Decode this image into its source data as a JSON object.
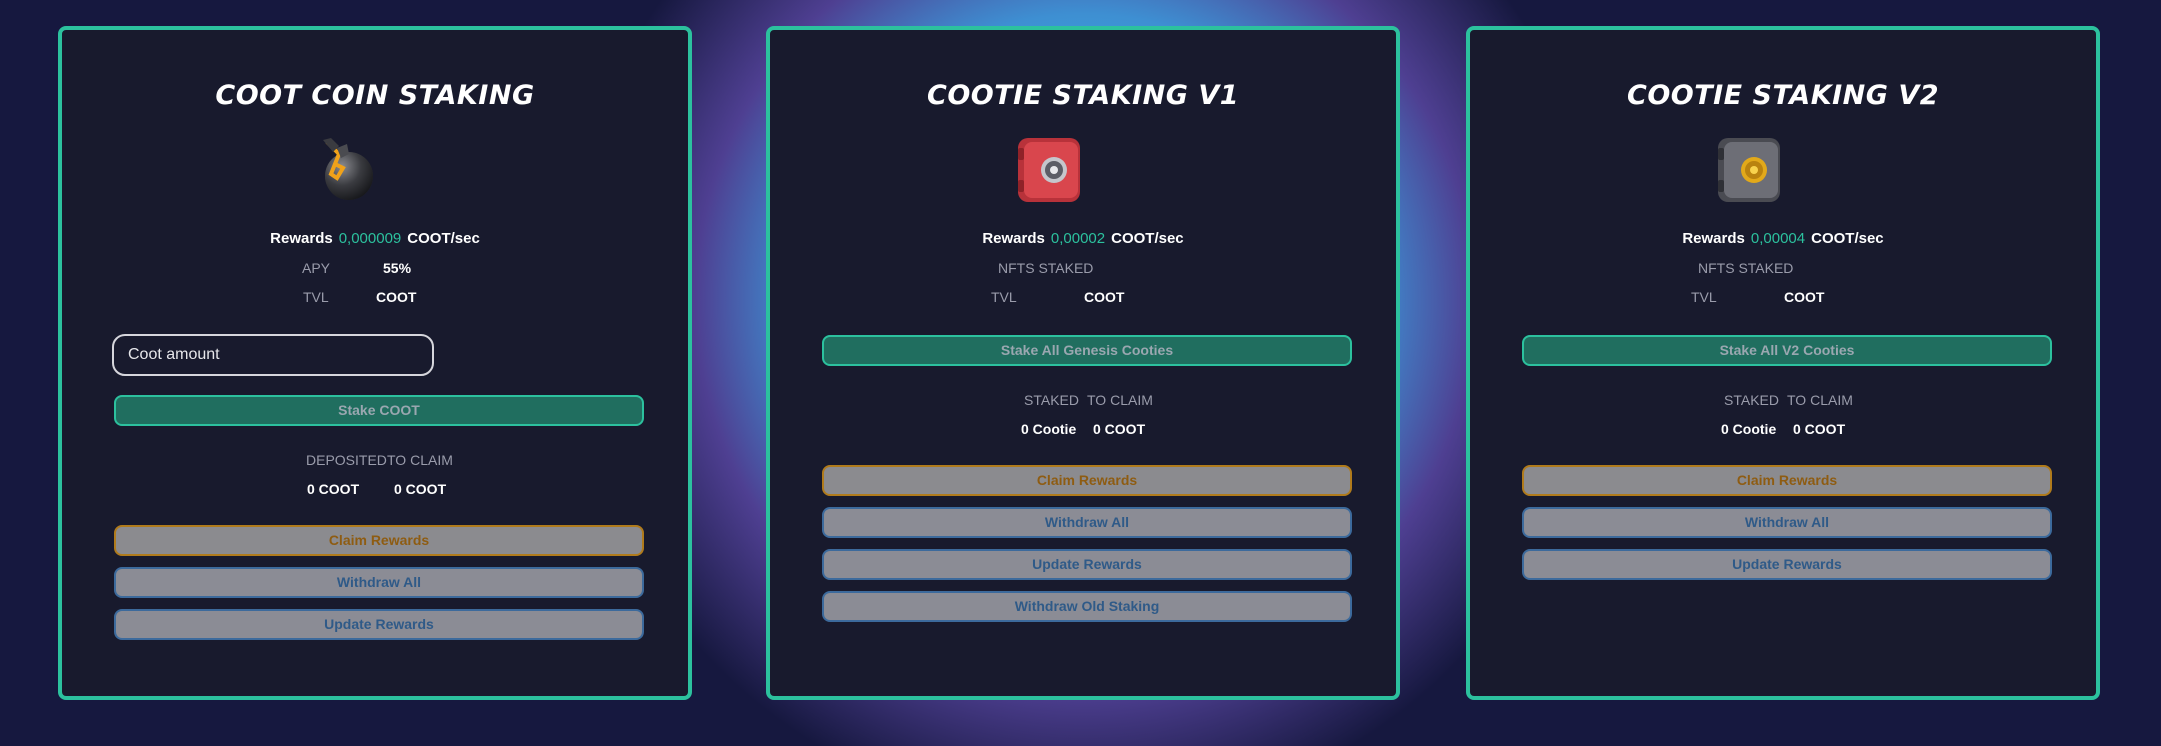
{
  "colors": {
    "accent": "#2cc19e",
    "card_bg": "#181a2d",
    "gold": "#b07b1c",
    "blue": "#3c6a9c"
  },
  "cards": [
    {
      "title": "COOT COIN STAKING",
      "icon": "bomb-icon",
      "rewards_label": "Rewards",
      "rewards_value": "0,000009",
      "rewards_unit": "COOT/sec",
      "row1_label": "APY",
      "row1_value": "55%",
      "row2_label": "TVL",
      "row2_value": "COOT",
      "input_placeholder": "Coot amount",
      "stake_button": "Stake COOT",
      "col1_label": "DEPOSITED",
      "col2_label": "TO CLAIM",
      "col1_value": "0 COOT",
      "col2_value": "0 COOT",
      "claim_button": "Claim Rewards",
      "withdraw_button": "Withdraw All",
      "update_button": "Update Rewards"
    },
    {
      "title": "COOTIE STAKING V1",
      "icon": "red-safe-icon",
      "rewards_label": "Rewards",
      "rewards_value": "0,00002",
      "rewards_unit": "COOT/sec",
      "row1_label": "NFTS STAKED",
      "row1_value": "",
      "row2_label": "TVL",
      "row2_value": "COOT",
      "stake_button": "Stake All Genesis Cooties",
      "col1_label": "STAKED",
      "col2_label": "TO CLAIM",
      "col1_value": "0 Cootie",
      "col2_value": "0 COOT",
      "claim_button": "Claim Rewards",
      "withdraw_button": "Withdraw All",
      "update_button": "Update Rewards",
      "withdraw_old_button": "Withdraw Old Staking"
    },
    {
      "title": "COOTIE STAKING V2",
      "icon": "grey-safe-icon",
      "rewards_label": "Rewards",
      "rewards_value": "0,00004",
      "rewards_unit": "COOT/sec",
      "row1_label": "NFTS STAKED",
      "row1_value": "",
      "row2_label": "TVL",
      "row2_value": "COOT",
      "stake_button": "Stake All V2 Cooties",
      "col1_label": "STAKED",
      "col2_label": "TO CLAIM",
      "col1_value": "0 Cootie",
      "col2_value": "0 COOT",
      "claim_button": "Claim Rewards",
      "withdraw_button": "Withdraw All",
      "update_button": "Update Rewards"
    }
  ]
}
